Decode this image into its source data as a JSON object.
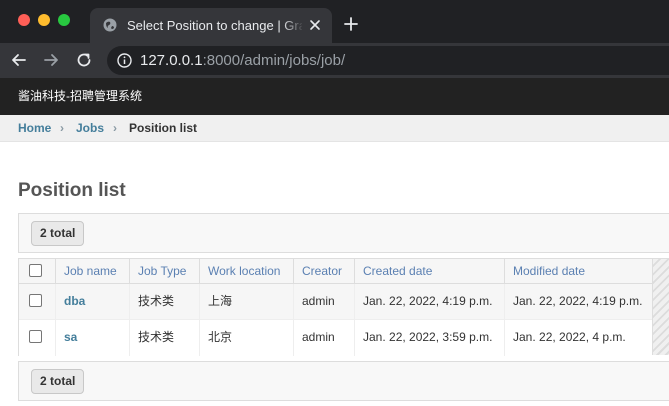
{
  "browser": {
    "tab_title": "Select Position to change | Gra",
    "url_host": "127.0.0.1",
    "url_path": ":8000/admin/jobs/job/"
  },
  "header": {
    "site_name": "酱油科技-招聘管理系统"
  },
  "breadcrumbs": {
    "home": "Home",
    "sep": "›",
    "jobs": "Jobs",
    "current": "Position list"
  },
  "page": {
    "title": "Position list",
    "total_label": "2 total"
  },
  "table": {
    "columns": [
      "Job name",
      "Job Type",
      "Work location",
      "Creator",
      "Created date",
      "Modified date"
    ],
    "rows": [
      {
        "job_name": "dba",
        "job_type": "技术类",
        "location": "上海",
        "creator": "admin",
        "created": "Jan. 22, 2022, 4:19 p.m.",
        "modified": "Jan. 22, 2022, 4:19 p.m."
      },
      {
        "job_name": "sa",
        "job_type": "技术类",
        "location": "北京",
        "creator": "admin",
        "created": "Jan. 22, 2022, 3:59 p.m.",
        "modified": "Jan. 22, 2022, 4 p.m."
      }
    ]
  },
  "colors": {
    "link": "#447e9b",
    "header_bg": "#222222",
    "browser_bg": "#202124"
  },
  "icons": {
    "favicon": "globe-icon",
    "close": "close-icon",
    "new_tab": "plus-icon",
    "back": "back-arrow-icon",
    "forward": "forward-arrow-icon",
    "reload": "reload-icon",
    "info": "info-icon"
  }
}
